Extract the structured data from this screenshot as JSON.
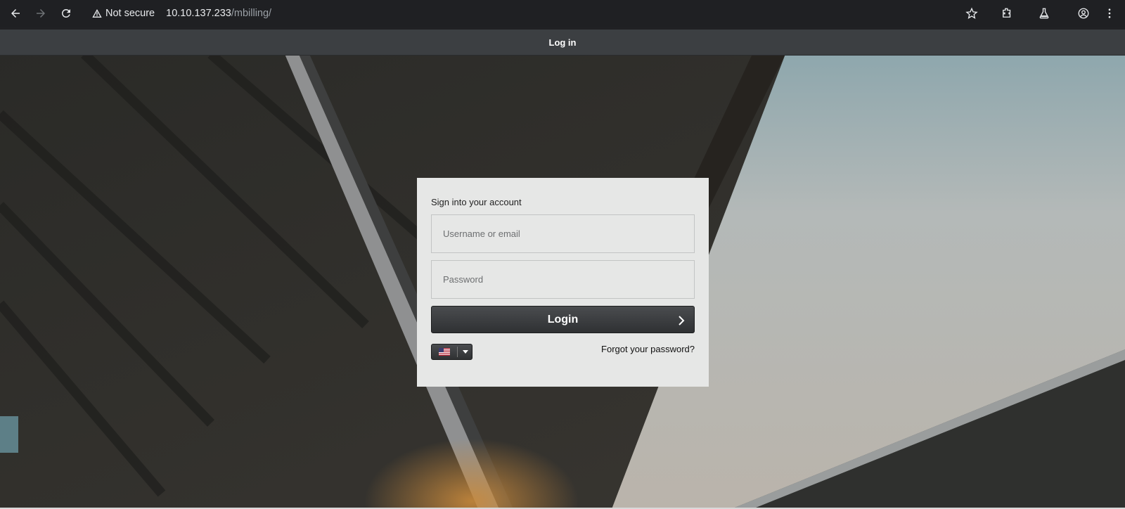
{
  "browser": {
    "security_label": "Not secure",
    "url_host": "10.10.137.233",
    "url_path": "/mbilling/"
  },
  "page": {
    "topbar_title": "Log in"
  },
  "login": {
    "heading": "Sign into your account",
    "username_placeholder": "Username or email",
    "password_placeholder": "Password",
    "submit_label": "Login",
    "forgot_label": "Forgot your password?",
    "language_flag": "us-flag-icon"
  },
  "colors": {
    "topbar": "#3c3f42",
    "panel": "#e6e7e6",
    "button": "#3a3c3e"
  }
}
